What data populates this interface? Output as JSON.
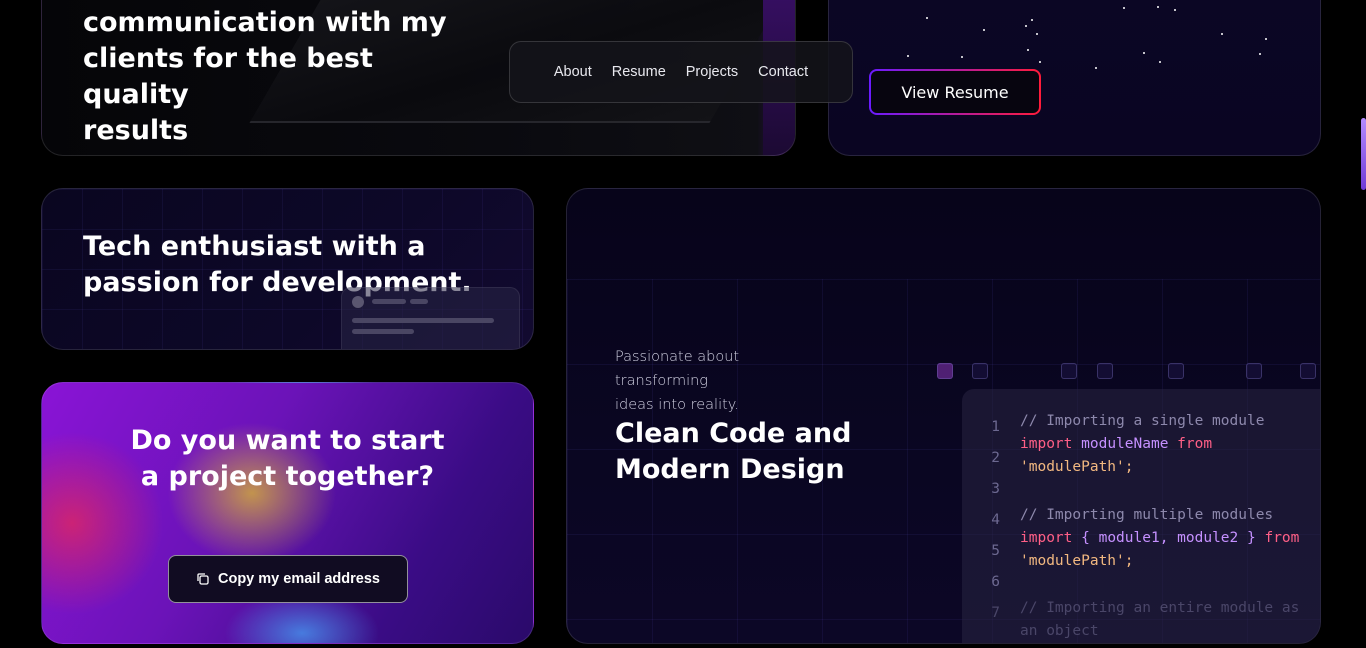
{
  "intro_card": {
    "lines": [
      "communication with my",
      "clients for the best quality",
      "results"
    ]
  },
  "nav": {
    "items": [
      "About",
      "Resume",
      "Projects",
      "Contact"
    ]
  },
  "resume": {
    "button_label": "View Resume"
  },
  "tech_card": {
    "title": "Tech enthusiast with a passion for development."
  },
  "project_card": {
    "title": "Do you want to start a project together?",
    "copy_button_label": "Copy my email address",
    "copy_icon": "copy-icon"
  },
  "clean_card": {
    "subtitle_lines": [
      "Passionate about",
      "transforming",
      "ideas into reality."
    ],
    "title": "Clean Code and Modern Design",
    "code": {
      "line_numbers": [
        "1",
        "2",
        "3",
        "4",
        "5",
        "6",
        "7"
      ],
      "comment_single": "// Importing a single module",
      "import_kw": "import",
      "module_name": "moduleName",
      "from_kw": "from",
      "module_path": "'modulePath';",
      "comment_multi": "// Importing multiple modules",
      "import_multi_body": "{ module1, module2 }",
      "comment_entire": "// Importing an entire module as",
      "entire_tail": "an object"
    }
  },
  "colors": {
    "accent_purple": "#6a1bff",
    "accent_red": "#ff1b3a",
    "background": "#000000"
  }
}
